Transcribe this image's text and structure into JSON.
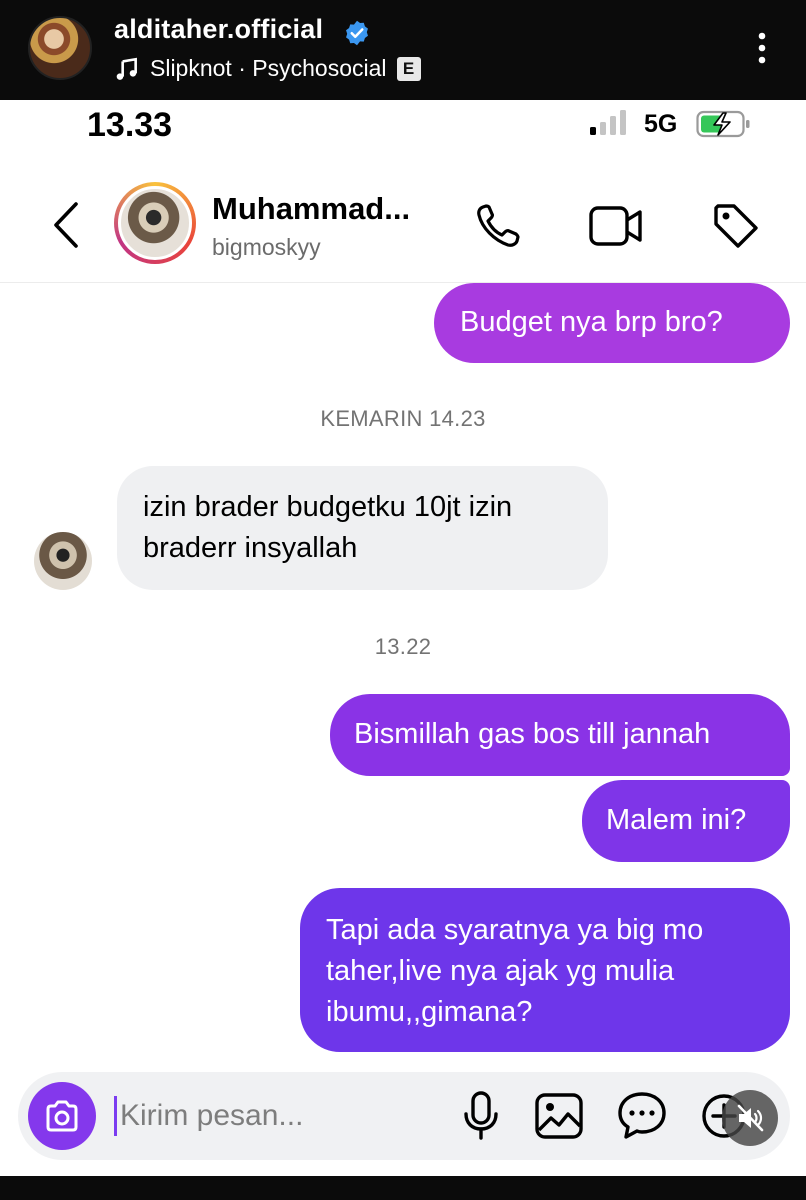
{
  "outer_header": {
    "account_name": "alditaher.official",
    "song": "Slipknot · Psychosocial",
    "explicit_badge": "E"
  },
  "status_bar": {
    "time": "13.33",
    "network": "5G"
  },
  "chat_header": {
    "name": "Muhammad...",
    "username": "bigmoskyy"
  },
  "messages": [
    {
      "direction": "outgoing",
      "text": "Budget nya brp bro?"
    },
    {
      "direction": "incoming",
      "text": "izin brader budgetku 10jt izin braderr insyallah"
    },
    {
      "direction": "outgoing",
      "text": "Bismillah gas bos till jannah"
    },
    {
      "direction": "outgoing",
      "text": "Malem ini?"
    },
    {
      "direction": "outgoing",
      "text": "Tapi ada syaratnya ya big mo taher,live nya ajak yg mulia ibumu,,gimana?"
    }
  ],
  "timestamps": [
    "KEMARIN 14.23",
    "13.22"
  ],
  "composer": {
    "placeholder": "Kirim pesan..."
  },
  "colors": {
    "accent": "#8438ec",
    "outgoing_top": "#a83be0",
    "outgoing_bottom": "#6e36ea",
    "incoming": "#eff0f2"
  }
}
